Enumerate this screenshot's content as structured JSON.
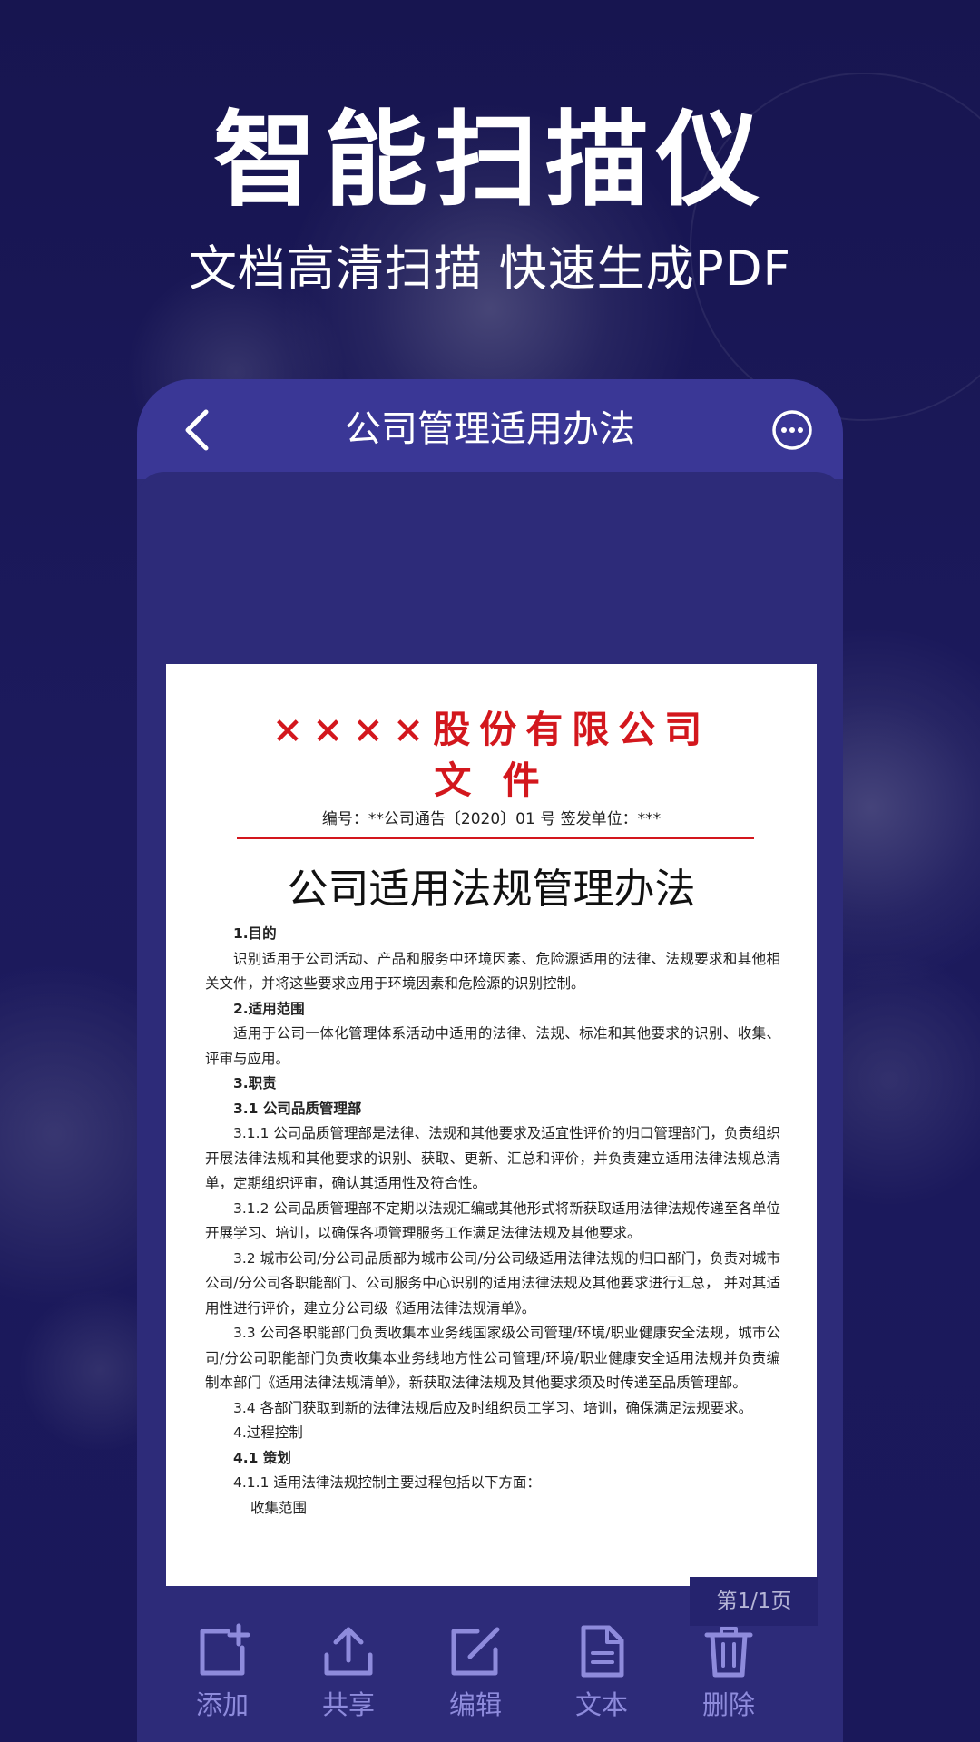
{
  "hero": {
    "title": "智能扫描仪",
    "subtitle": "文档高清扫描  快速生成PDF"
  },
  "header": {
    "title": "公司管理适用办法",
    "back_icon": "chevron-left-icon",
    "more_icon": "more-dots-icon"
  },
  "document": {
    "company": "××××股份有限公司",
    "file_label": "文 件",
    "file_no": "编号：**公司通告〔2020〕01 号  签发单位：***",
    "title": "公司适用法规管理办法",
    "lines": [
      {
        "style": "head",
        "text": "1.目的"
      },
      {
        "style": "para",
        "text": "识别适用于公司活动、产品和服务中环境因素、危险源适用的法律、法规要求和其他相关文件，并将这些要求应用于环境因素和危险源的识别控制。"
      },
      {
        "style": "head",
        "text": "2.适用范围"
      },
      {
        "style": "para",
        "text": "适用于公司一体化管理体系活动中适用的法律、法规、标准和其他要求的识别、收集、评审与应用。"
      },
      {
        "style": "head",
        "text": "3.职责"
      },
      {
        "style": "head",
        "text": "3.1 公司品质管理部"
      },
      {
        "style": "para",
        "text": "3.1.1 公司品质管理部是法律、法规和其他要求及适宜性评价的归口管理部门，负责组织开展法律法规和其他要求的识别、获取、更新、汇总和评价，并负责建立适用法律法规总清单，定期组织评审，确认其适用性及符合性。"
      },
      {
        "style": "para",
        "text": "3.1.2 公司品质管理部不定期以法规汇编或其他形式将新获取适用法律法规传递至各单位开展学习、培训，以确保各项管理服务工作满足法律法规及其他要求。"
      },
      {
        "style": "para",
        "text": "3.2 城市公司/分公司品质部为城市公司/分公司级适用法律法规的归口部门，负责对城市公司/分公司各职能部门、公司服务中心识别的适用法律法规及其他要求进行汇总，  并对其适用性进行评价，建立分公司级《适用法律法规清单》。"
      },
      {
        "style": "para",
        "text": "3.3 公司各职能部门负责收集本业务线国家级公司管理/环境/职业健康安全法规，城市公司/分公司职能部门负责收集本业务线地方性公司管理/环境/职业健康安全适用法规并负责编制本部门《适用法律法规清单》，新获取法律法规及其他要求须及时传递至品质管理部。"
      },
      {
        "style": "para",
        "text": "3.4 各部门获取到新的法律法规后应及时组织员工学习、培训，确保满足法规要求。"
      },
      {
        "style": "plain",
        "text": "4.过程控制"
      },
      {
        "style": "head",
        "text": "4.1 策划"
      },
      {
        "style": "plain",
        "text": "4.1.1 适用法律法规控制主要过程包括以下方面："
      },
      {
        "style": "sub",
        "text": "收集范围"
      }
    ]
  },
  "page_indicator": "第1/1页",
  "toolbar": {
    "items": [
      {
        "label": "添加",
        "icon": "add-page-icon"
      },
      {
        "label": "共享",
        "icon": "share-icon"
      },
      {
        "label": "编辑",
        "icon": "edit-icon"
      },
      {
        "label": "文本",
        "icon": "text-document-icon"
      },
      {
        "label": "删除",
        "icon": "trash-icon"
      }
    ]
  },
  "colors": {
    "background": "#1a185a",
    "panel": "#2d2b79",
    "header": "#3a3796",
    "toolbar_icon": "#8e8bdc",
    "document_red": "#d3171d"
  }
}
